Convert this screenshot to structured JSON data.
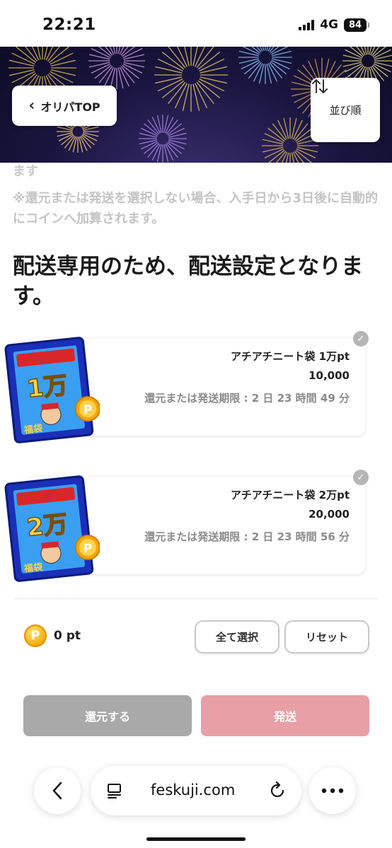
{
  "status_bar": {
    "time": "22:21",
    "network": "4G",
    "battery": "84"
  },
  "header": {
    "back_label": "オリパTOP",
    "sort_label": "並び順"
  },
  "notices": {
    "cut_text": "ます",
    "auto_coin_text": "※還元または発送を選択しない場合、入手日から3日後に自動的にコインへ加算されます。",
    "headline": "配送専用のため、配送設定となります。"
  },
  "items": [
    {
      "name": "アチアチニート袋 1万pt",
      "value": "10,000",
      "deadline": "還元または発送期限 : 2 日 23 時間 49 分",
      "badge": "1万",
      "tag": "福袋",
      "coin": "P",
      "selected": true
    },
    {
      "name": "アチアチニート袋 2万pt",
      "value": "20,000",
      "deadline": "還元または発送期限 : 2 日 23 時間 56 分",
      "badge": "2万",
      "tag": "福袋",
      "coin": "P",
      "selected": true
    }
  ],
  "footer": {
    "coin_symbol": "P",
    "points": "0 pt",
    "select_all_label": "全て選択",
    "reset_label": "リセット",
    "return_label": "還元する",
    "ship_label": "発送"
  },
  "browser": {
    "url": "feskuji.com"
  },
  "colors": {
    "ship_button": "#e89fa6",
    "return_button": "#a9a9a9",
    "banner_bg": "#1a1540",
    "coin_gold": "#f5a700"
  },
  "icons": {
    "back": "chevron-left-icon",
    "sort": "sort-arrows-icon",
    "check": "checkmark-icon",
    "browser_back": "chevron-left-icon",
    "reader": "reader-icon",
    "reload": "reload-icon",
    "more": "more-dots-icon"
  }
}
